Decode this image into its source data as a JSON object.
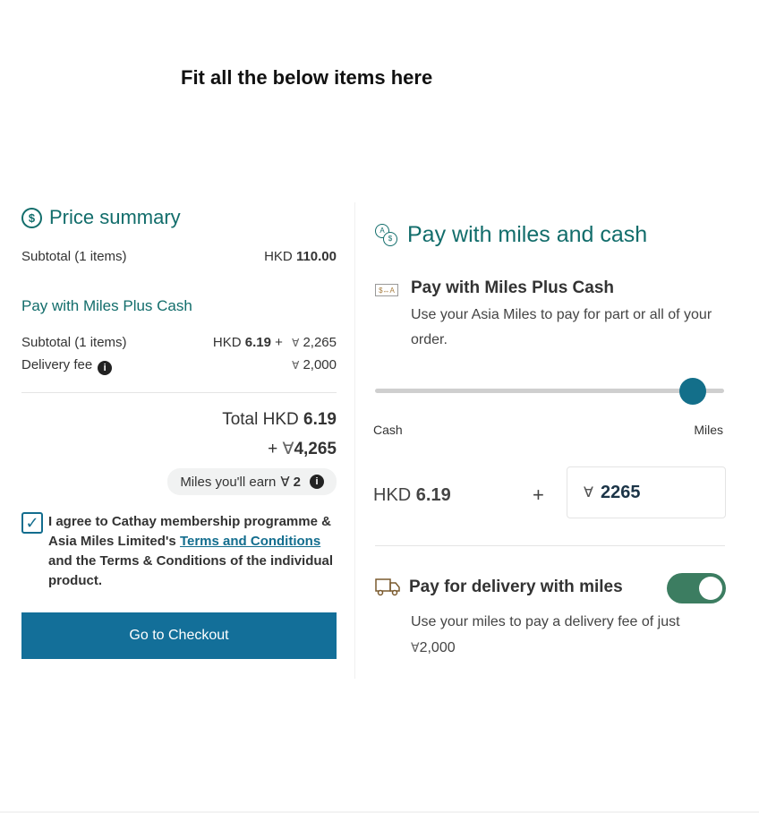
{
  "instruction": "Fit all the below items here",
  "price_summary": {
    "title": "Price summary",
    "icon": "dollar-circle-icon",
    "subtotal_label": "Subtotal (1 items)",
    "subtotal_currency": "HKD",
    "subtotal_value": "110.00",
    "mpc_heading": "Pay with Miles Plus Cash",
    "mpc_subtotal_label": "Subtotal (1 items)",
    "mpc_subtotal_currency": "HKD",
    "mpc_subtotal_cash": "6.19",
    "mpc_plus": "+",
    "mpc_subtotal_miles": "2,265",
    "delivery_label": "Delivery fee",
    "delivery_miles": "2,000",
    "total_label": "Total HKD",
    "total_cash": "6.19",
    "total_plus": "+",
    "total_miles": "4,265",
    "earn_label": "Miles you'll earn",
    "earn_value": "2",
    "agree_text_1": "I agree to Cathay membership programme & Asia Miles Limited's",
    "agree_link": "Terms and Conditions",
    "agree_text_2": "and the Terms & Conditions of the individual product.",
    "agree_checked": true,
    "checkout_label": "Go to Checkout"
  },
  "pay_panel": {
    "title": "Pay with miles and cash",
    "icon": "coins-icon",
    "mpc_title": "Pay with Miles Plus Cash",
    "mpc_icon_text": "$↔A",
    "mpc_desc": "Use your Asia Miles to pay for part or all of your order.",
    "slider_min_label": "Cash",
    "slider_max_label": "Miles",
    "slider_position": 0.91,
    "cash_currency": "HKD",
    "cash_value": "6.19",
    "plus": "+",
    "miles_value": "2265",
    "delivery_title": "Pay for delivery with miles",
    "delivery_desc_1": "Use your miles to pay a delivery fee of just",
    "delivery_desc_miles": "2,000",
    "delivery_toggle_on": true
  },
  "colors": {
    "teal": "#126d6b",
    "button": "#136f99",
    "toggle": "#3c7d61"
  },
  "miles_symbol": "Ɐ"
}
